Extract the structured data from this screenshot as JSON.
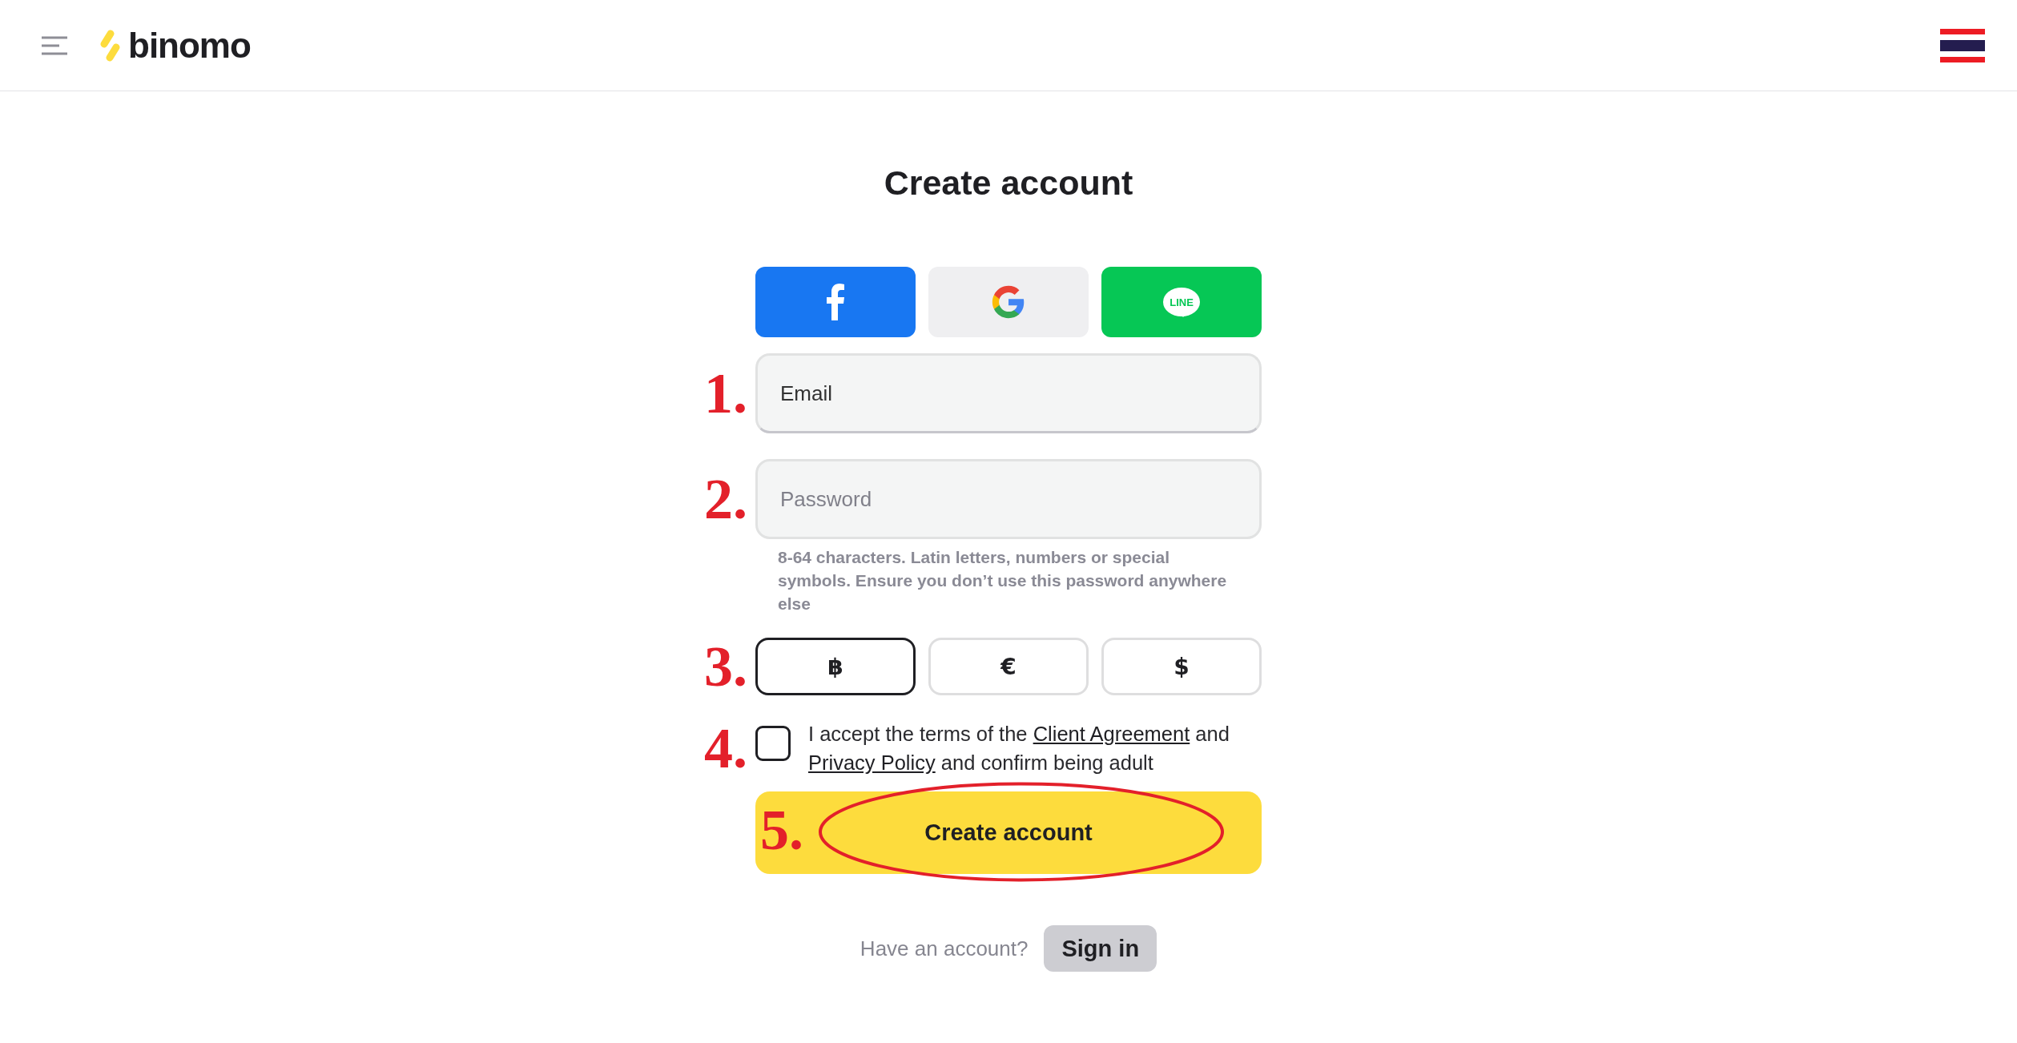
{
  "header": {
    "logo_text": "binomo"
  },
  "title": "Create account",
  "social_buttons": [
    {
      "kind": "facebook"
    },
    {
      "kind": "google"
    },
    {
      "kind": "line",
      "label": "LINE"
    }
  ],
  "email": {
    "placeholder": "Email",
    "marker": "1."
  },
  "password": {
    "placeholder": "Password",
    "marker": "2.",
    "hint": "8-64 characters. Latin letters, numbers or special symbols. Ensure you don’t use this password anywhere else"
  },
  "currencies": {
    "marker": "3.",
    "items": [
      {
        "symbol": "฿",
        "selected": true
      },
      {
        "symbol": "€",
        "selected": false
      },
      {
        "symbol": "$",
        "selected": false
      }
    ]
  },
  "terms": {
    "marker": "4.",
    "checked": false,
    "segments": [
      {
        "kind": "text",
        "text": "I accept the terms of the "
      },
      {
        "kind": "link",
        "text": "Client Agreement"
      },
      {
        "kind": "text",
        "text": " and "
      },
      {
        "kind": "link",
        "text": "Privacy Policy"
      },
      {
        "kind": "text",
        "text": " and confirm being adult"
      }
    ]
  },
  "submit": {
    "label": "Create account",
    "marker": "5.",
    "circled": true
  },
  "signin": {
    "prompt": "Have an account?",
    "button": "Sign in"
  }
}
